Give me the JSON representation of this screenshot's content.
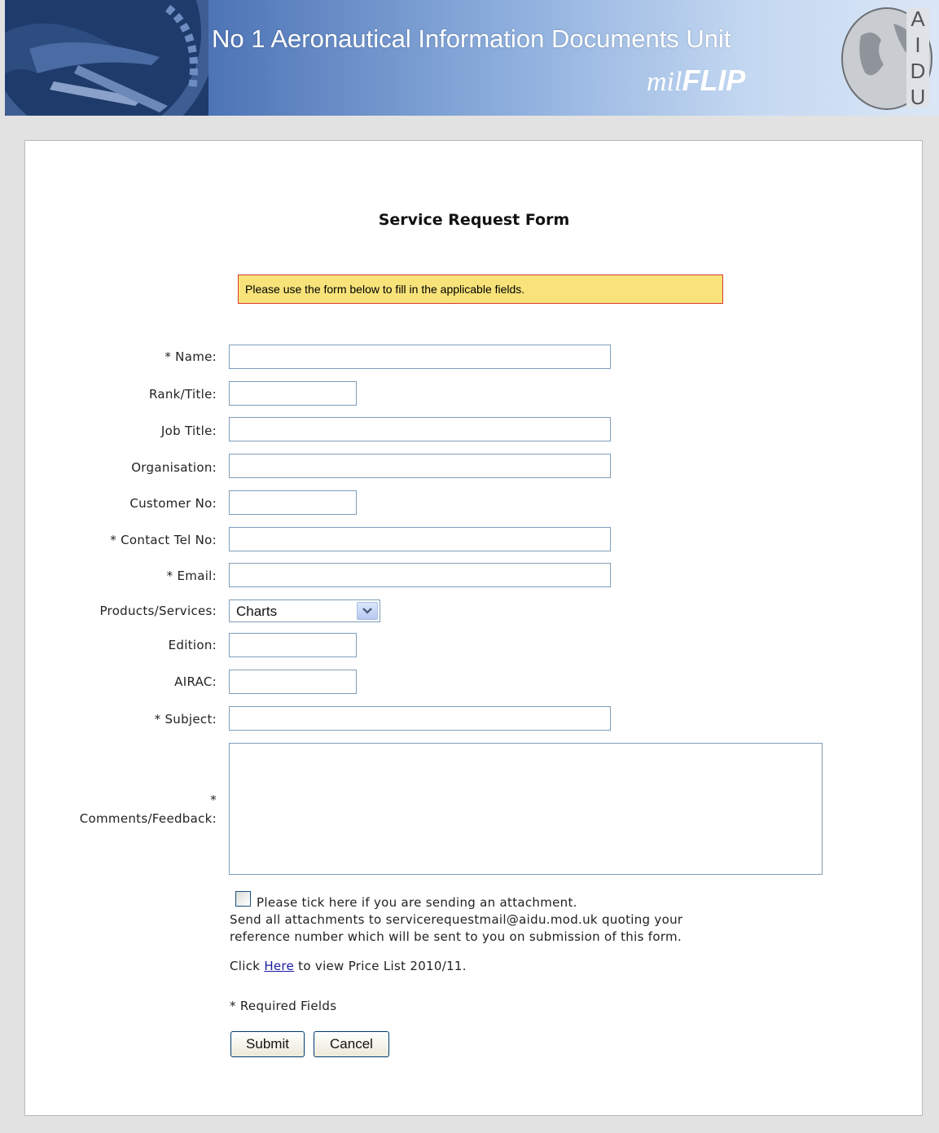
{
  "header": {
    "title": "No 1 Aeronautical Information Documents Unit",
    "subtitle_prefix": "mil",
    "subtitle_bold": "FLIP",
    "logo_letters": [
      "A",
      "I",
      "D",
      "U"
    ]
  },
  "form": {
    "title": "Service Request Form",
    "notice": "Please use the form below to fill in the applicable fields.",
    "labels": {
      "name": "* Name:",
      "rank": "Rank/Title:",
      "job_title": "Job Title:",
      "organisation": "Organisation:",
      "customer_no": "Customer No:",
      "contact_tel": "* Contact Tel No:",
      "email": "* Email:",
      "products": "Products/Services:",
      "edition": "Edition:",
      "airac": "AIRAC:",
      "subject": "* Subject:",
      "comments_star": "*",
      "comments": "Comments/Feedback:"
    },
    "products_selected": "Charts",
    "attachment_label": "Please tick here if you are sending an attachment.",
    "attachment_note_1": "Send all attachments to servicerequestmail@aidu.mod.uk quoting your",
    "attachment_note_2": "reference number which will be sent to you on submission of this form.",
    "price_prefix": "Click ",
    "price_link": "Here",
    "price_suffix": " to view Price List 2010/11.",
    "required_note": "* Required Fields",
    "submit_label": "Submit",
    "cancel_label": "Cancel"
  },
  "colors": {
    "banner": "#4d74b6",
    "notice_bg": "#f7e37a",
    "notice_border": "#d93a2e",
    "link": "#1a1aa6",
    "field_border": "#7f9db9"
  }
}
